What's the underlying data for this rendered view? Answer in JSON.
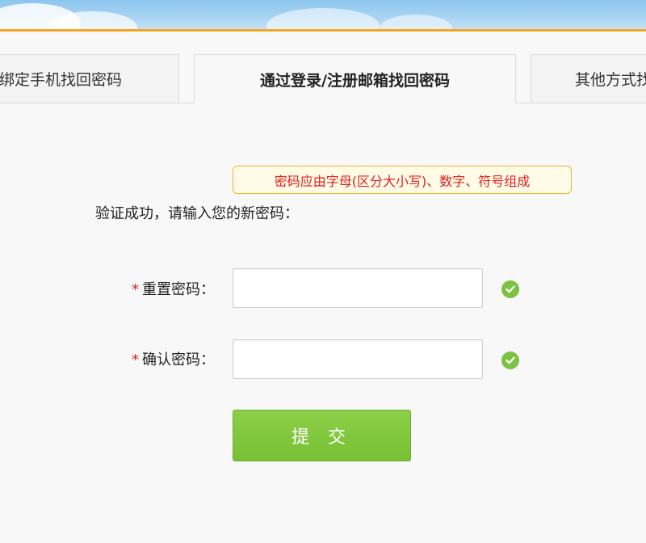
{
  "colors": {
    "accent_orange": "#f5a623",
    "required_red": "#e02020",
    "success_green": "#7cc242",
    "submit_green": "#80c63c"
  },
  "tabs": [
    {
      "label": "绑定手机找回密码",
      "active": false
    },
    {
      "label": "通过登录/注册邮箱找回密码",
      "active": true
    },
    {
      "label": "其他方式找回",
      "active": false
    }
  ],
  "hint": {
    "text": "密码应由字母(区分大小写)、数字、符号组成"
  },
  "verify_message": "验证成功，请输入您的新密码：",
  "form": {
    "required_mark": "*",
    "reset_password": {
      "label": "重置密码：",
      "value": "",
      "icon": "check-circle-icon"
    },
    "confirm_password": {
      "label": "确认密码：",
      "value": "",
      "icon": "check-circle-icon"
    },
    "submit_label": "提 交"
  }
}
